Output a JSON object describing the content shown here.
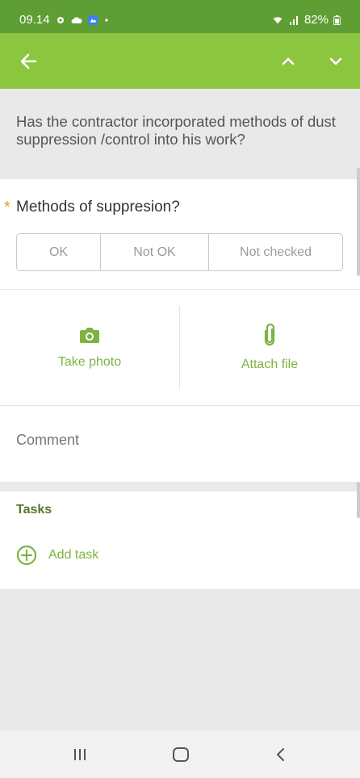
{
  "status_bar": {
    "time": "09.14",
    "battery": "82%",
    "icons": [
      "gear-icon",
      "cloud-icon",
      "app-badge-icon",
      "dot-icon",
      "wifi-icon",
      "signal-icon",
      "battery-icon"
    ]
  },
  "app_bar": {
    "icons": [
      "back-arrow-icon",
      "chevron-up-icon",
      "chevron-down-icon"
    ],
    "background": "#8cc63f",
    "status_background": "#5e9e35"
  },
  "question": {
    "text": "Has the contractor incorporated methods of dust suppression /control into his work?"
  },
  "answer": {
    "required_marker": "*",
    "label": "Methods of suppresion?",
    "options": [
      "OK",
      "Not OK",
      "Not checked"
    ]
  },
  "media": {
    "take_photo_label": "Take photo",
    "attach_file_label": "Attach file",
    "accent": "#7cb342"
  },
  "comment": {
    "placeholder": "Comment",
    "value": ""
  },
  "tasks": {
    "title": "Tasks",
    "add_label": "Add task"
  },
  "nav": {
    "icons": [
      "recents-icon",
      "home-icon",
      "back-icon"
    ]
  }
}
